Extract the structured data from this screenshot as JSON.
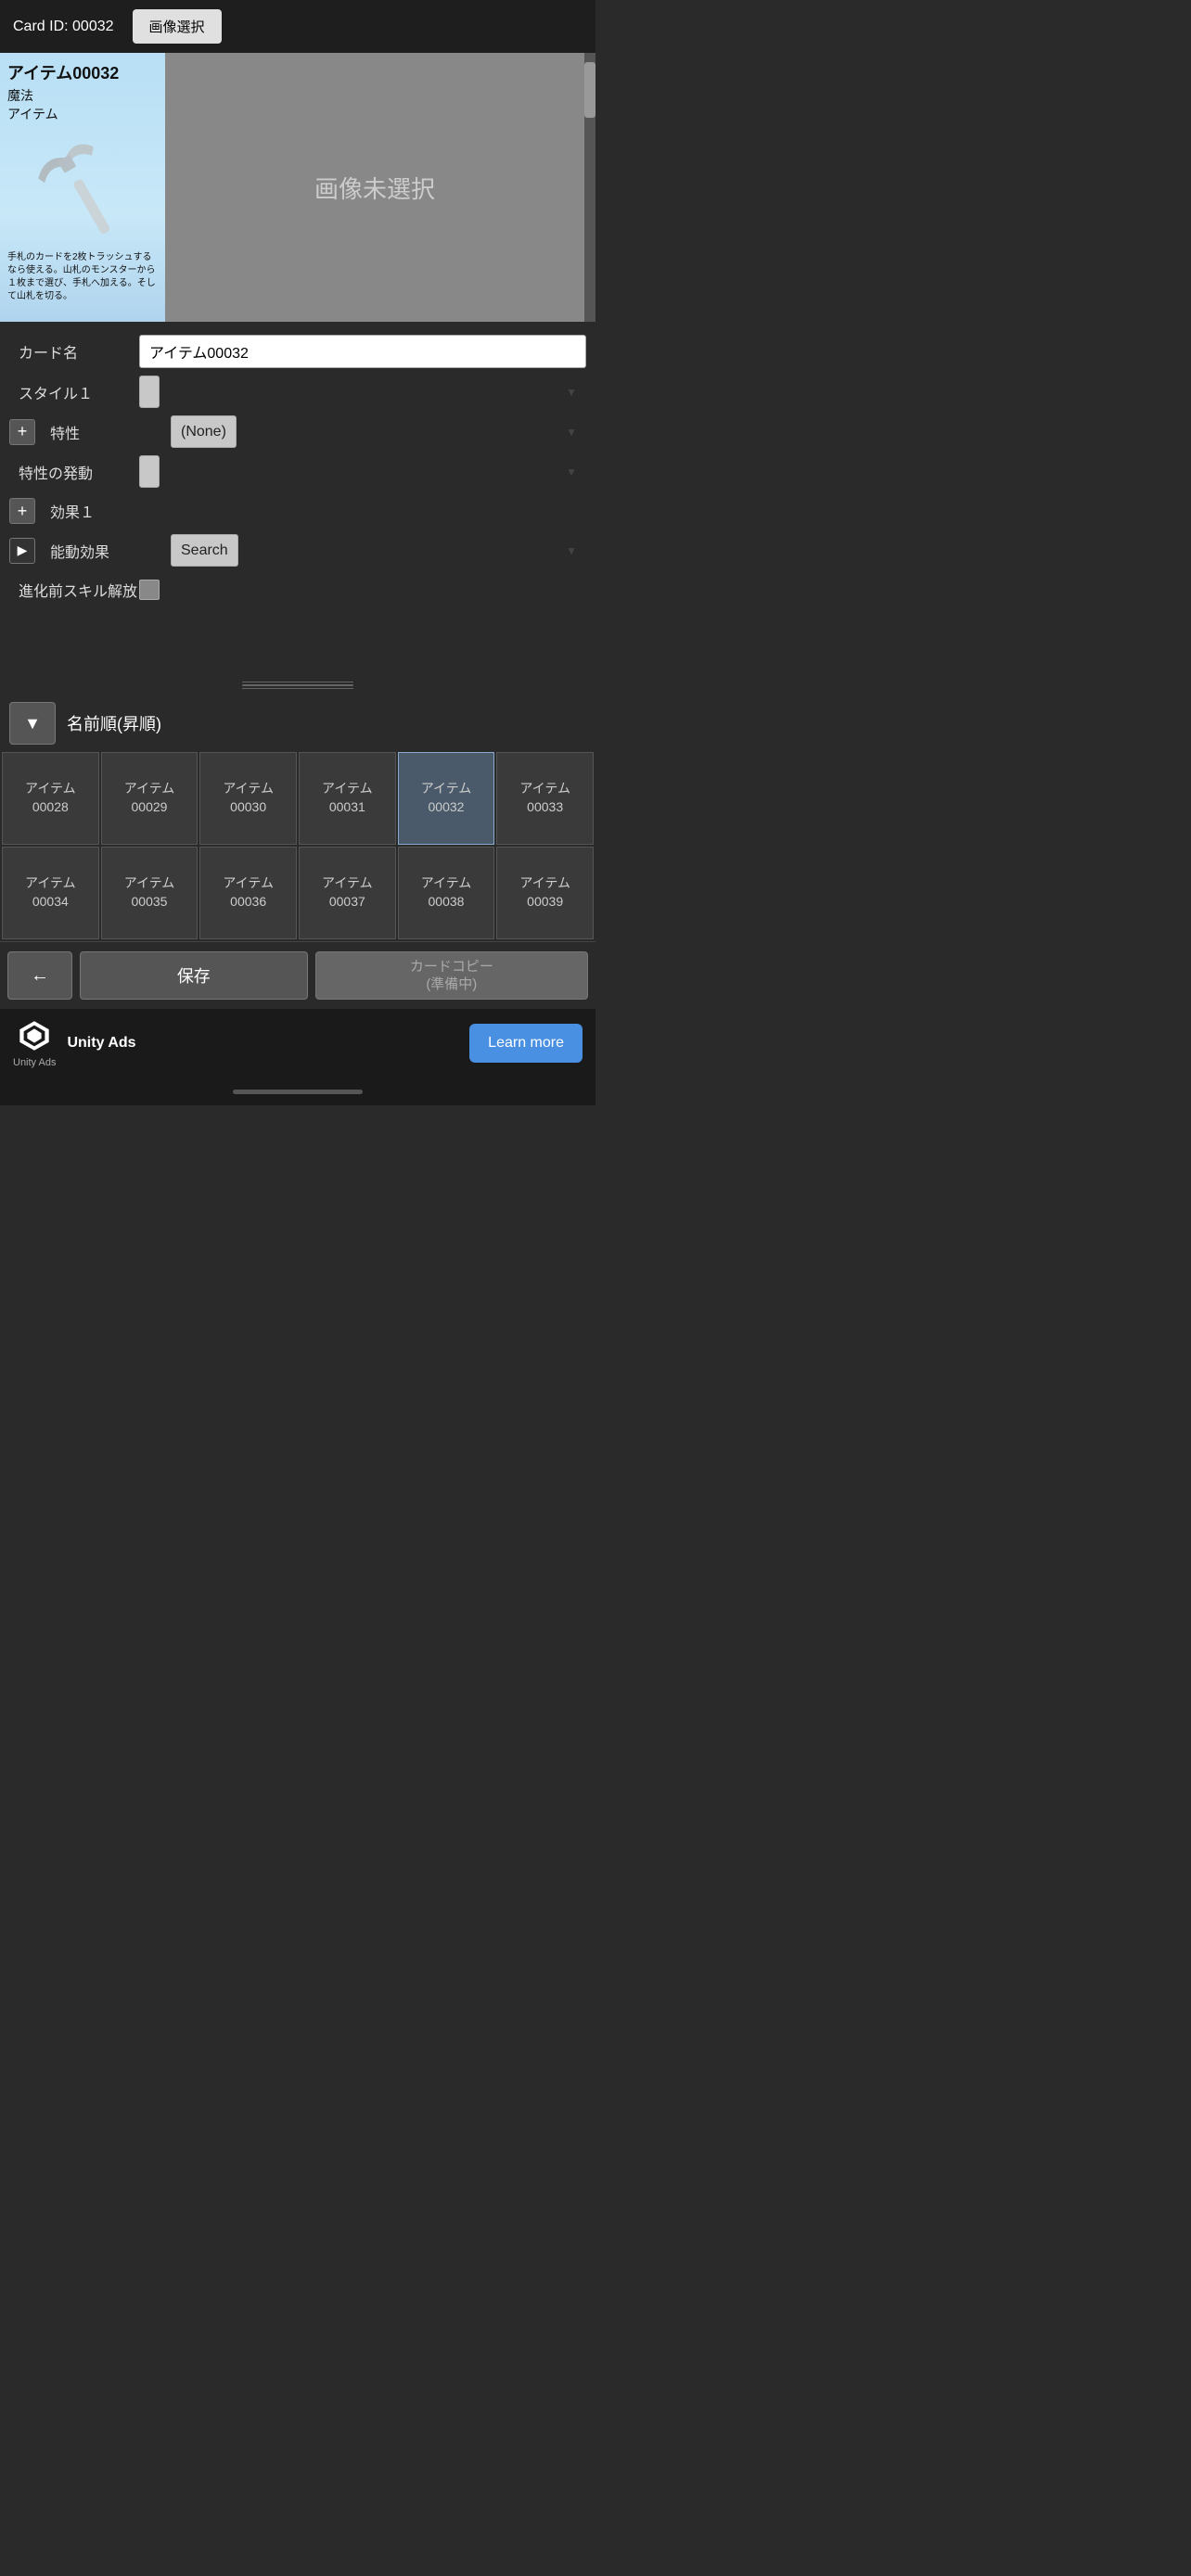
{
  "topBar": {
    "cardIdLabel": "Card ID: 00032",
    "imageSelectBtn": "画像選択"
  },
  "cardPreview": {
    "title": "アイテム00032",
    "typeLine1": "魔法",
    "typeLine2": "アイテム",
    "description": "手札のカードを2枚トラッシュするなら使える。山札のモンスターから１枚まで選び、手札へ加える。そして山札を切る。",
    "noImageText": "画像未選択"
  },
  "form": {
    "cardNameLabel": "カード名",
    "cardNameValue": "アイテム00032",
    "style1Label": "スタイル１",
    "style1Value": "",
    "traitLabel": "特性",
    "traitValue": "(None)",
    "traitTriggerLabel": "特性の発動",
    "traitTriggerValue": "",
    "effect1Label": "効果１",
    "activeEffectLabel": "能動効果",
    "activeEffectPlaceholder": "Search",
    "evolutionLabel": "進化前スキル解放"
  },
  "sortBar": {
    "sortLabel": "名前順(昇順)",
    "dropdownIcon": "▼"
  },
  "cardGrid": {
    "row1": [
      {
        "label": "アイテム\n00028",
        "selected": false
      },
      {
        "label": "アイテム\n00029",
        "selected": false
      },
      {
        "label": "アイテム\n00030",
        "selected": false
      },
      {
        "label": "アイテム\n00031",
        "selected": false
      },
      {
        "label": "アイテム\n00032",
        "selected": true
      },
      {
        "label": "アイテム\n00033",
        "selected": false
      }
    ],
    "row2": [
      {
        "label": "アイテム\n00034",
        "selected": false
      },
      {
        "label": "アイテム\n00035",
        "selected": false
      },
      {
        "label": "アイテム\n00036",
        "selected": false
      },
      {
        "label": "アイテム\n00037",
        "selected": false
      },
      {
        "label": "アイテム\n00038",
        "selected": false
      },
      {
        "label": "アイテム\n00039",
        "selected": false
      }
    ]
  },
  "actionBar": {
    "backIcon": "←",
    "saveLabel": "保存",
    "copyLabel": "カードコピー\n(準備中)"
  },
  "adsBanner": {
    "brandName": "Unity Ads",
    "adsBrandSmall": "Unity  Ads",
    "learnMoreLabel": "Learn more"
  }
}
